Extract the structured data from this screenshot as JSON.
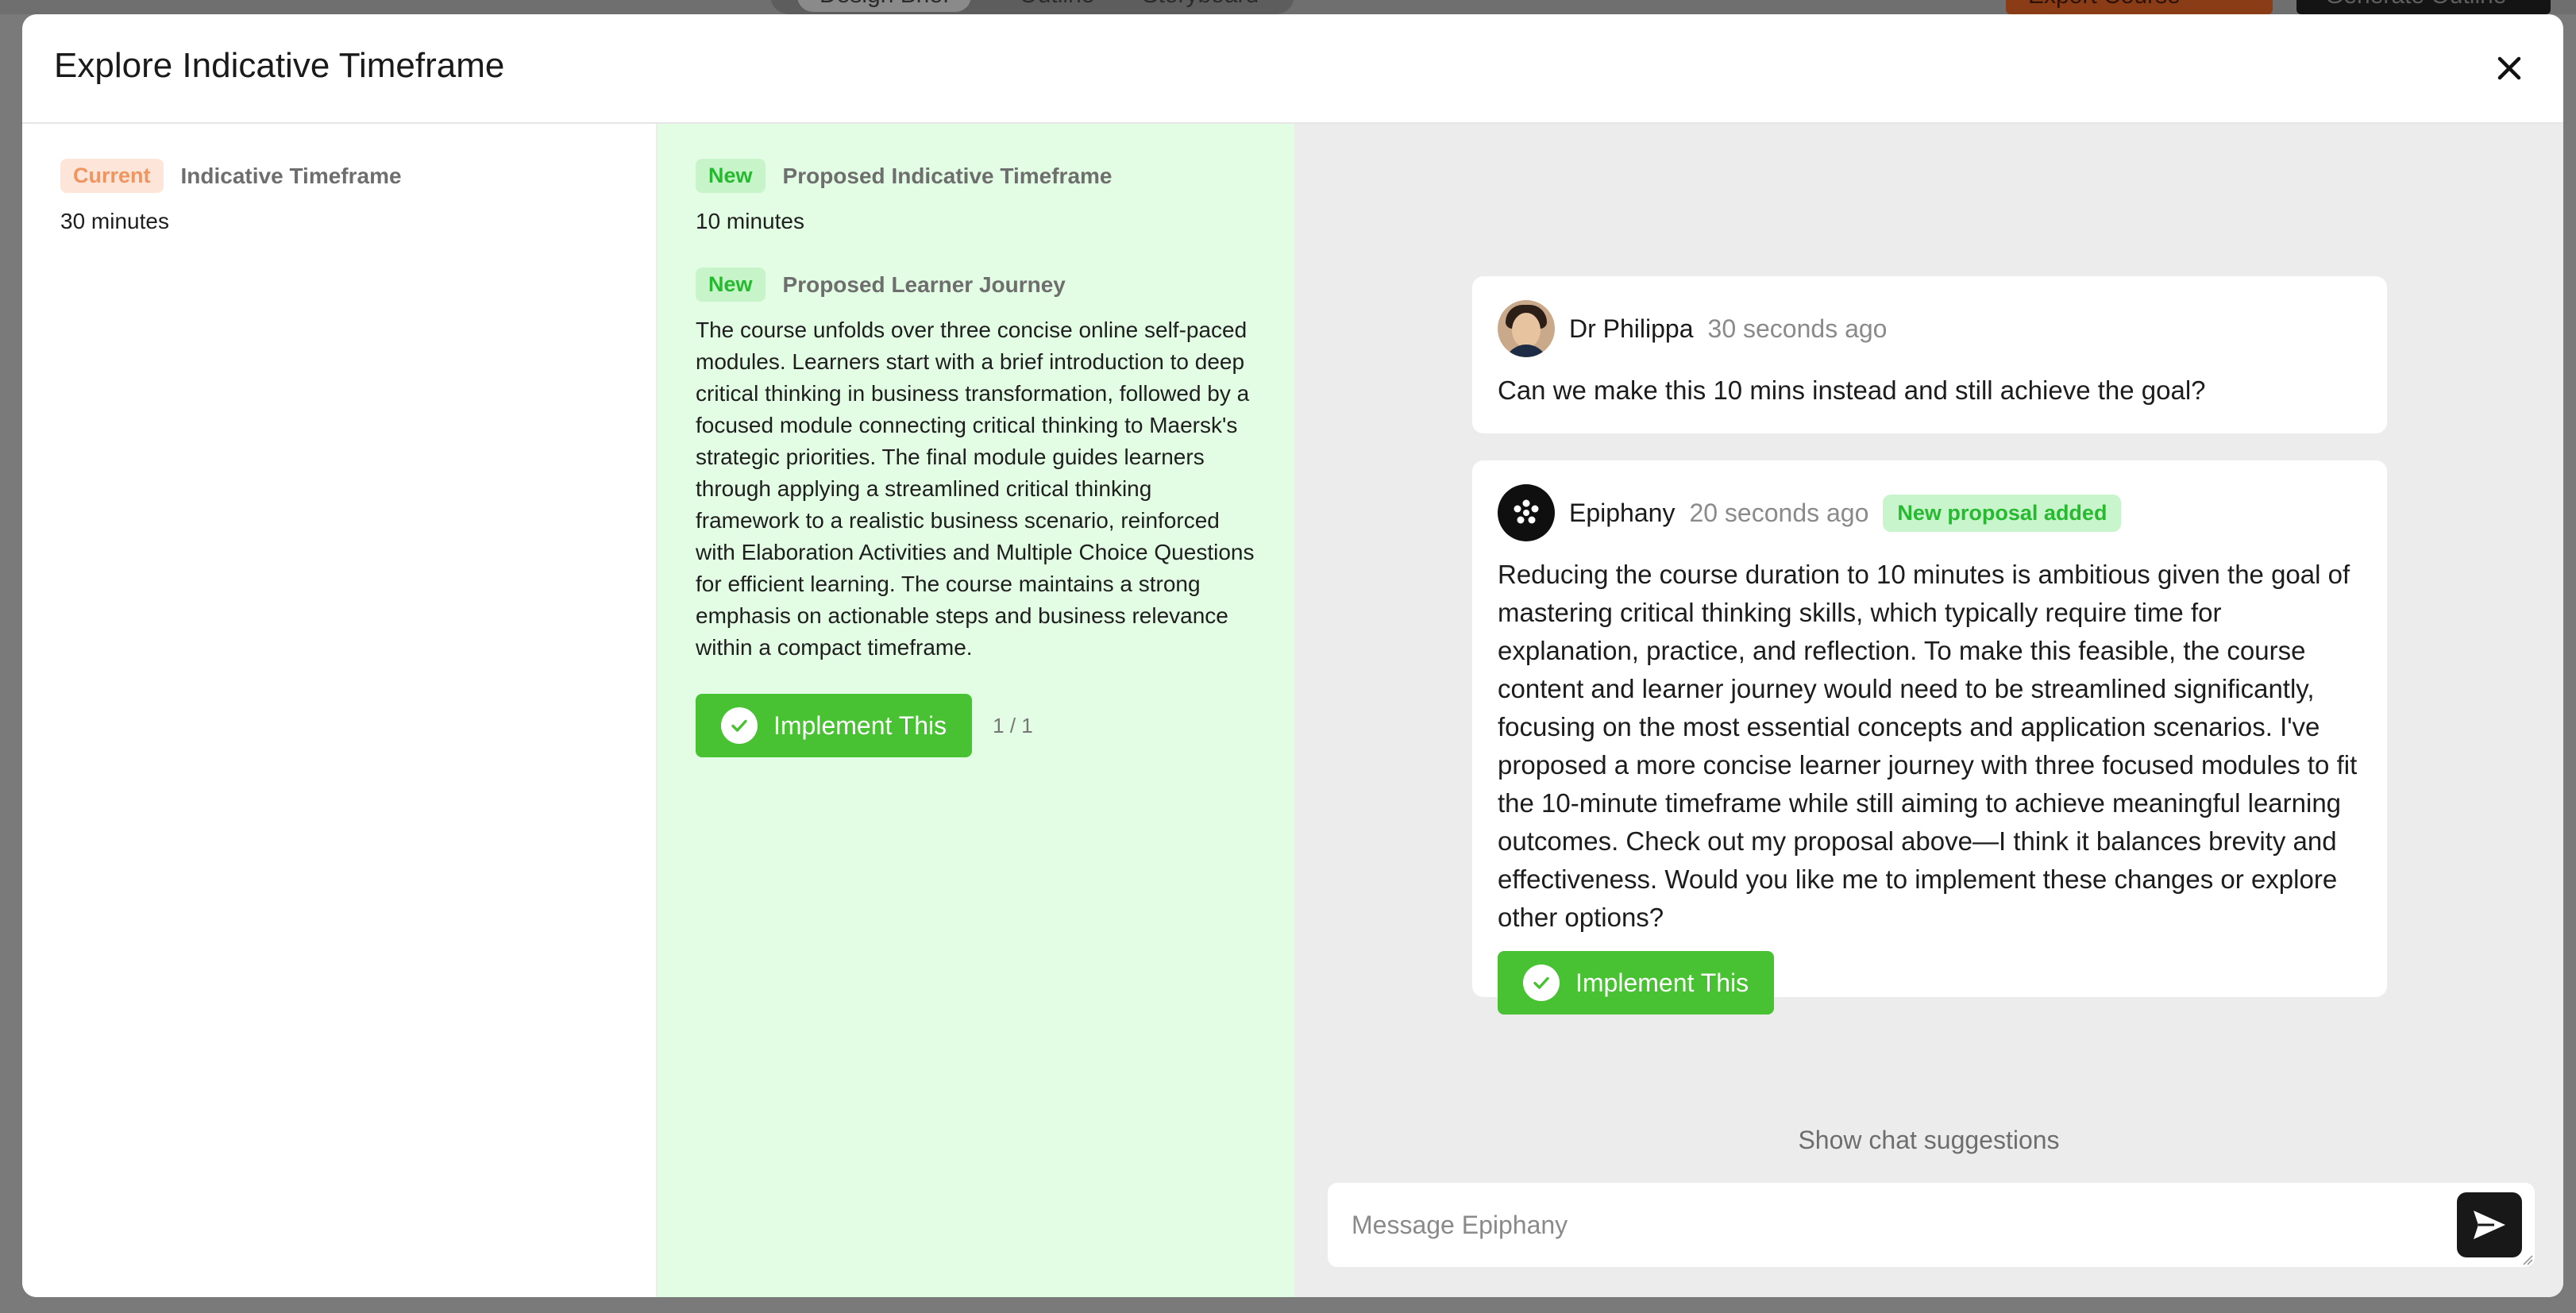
{
  "background": {
    "tabs": [
      "Design Brief",
      "Outline",
      "Storyboard"
    ],
    "export_label": "Export Course",
    "generate_label": "Generate Outline"
  },
  "modal": {
    "title": "Explore Indicative Timeframe"
  },
  "current": {
    "tag": "Current",
    "label": "Indicative Timeframe",
    "value": "30 minutes"
  },
  "proposal": {
    "timeframe": {
      "tag": "New",
      "label": "Proposed Indicative Timeframe",
      "value": "10 minutes"
    },
    "journey": {
      "tag": "New",
      "label": "Proposed Learner Journey",
      "value": "The course unfolds over three concise online self-paced modules. Learners start with a brief introduction to deep critical thinking in business transformation, followed by a focused module connecting critical thinking to Maersk's strategic priorities. The final module guides learners through applying a streamlined critical thinking framework to a realistic business scenario, reinforced with Elaboration Activities and Multiple Choice Questions for efficient learning. The course maintains a strong emphasis on actionable steps and business relevance within a compact timeframe."
    },
    "implement_label": "Implement This",
    "pager": "1 / 1"
  },
  "chat": {
    "messages": [
      {
        "author": "Dr Philippa",
        "time": "30 seconds ago",
        "text": "Can we make this 10 mins instead and still achieve the goal?"
      },
      {
        "author": "Epiphany",
        "time": "20 seconds ago",
        "badge": "New proposal added",
        "text": "Reducing the course duration to 10 minutes is ambitious given the goal of mastering critical thinking skills, which typically require time for explanation, practice, and reflection. To make this feasible, the course content and learner journey would need to be streamlined significantly, focusing on the most essential concepts and application scenarios. I've proposed a more concise learner journey with three focused modules to fit the 10-minute timeframe while still aiming to achieve meaningful learning outcomes. Check out my proposal above—I think it balances brevity and effectiveness. Would you like me to implement these changes or explore other options?",
        "implement_label": "Implement This"
      }
    ],
    "suggestions_label": "Show chat suggestions",
    "input": {
      "placeholder": "Message Epiphany",
      "value": ""
    }
  },
  "colors": {
    "accent_green": "#48c233",
    "new_panel_bg": "#e2fde3",
    "current_tag": "#f0955f",
    "chat_bg": "#ececec"
  },
  "icons": [
    "close-icon",
    "check-icon",
    "send-icon",
    "epiphany-logo-icon",
    "resize-handle-icon"
  ]
}
